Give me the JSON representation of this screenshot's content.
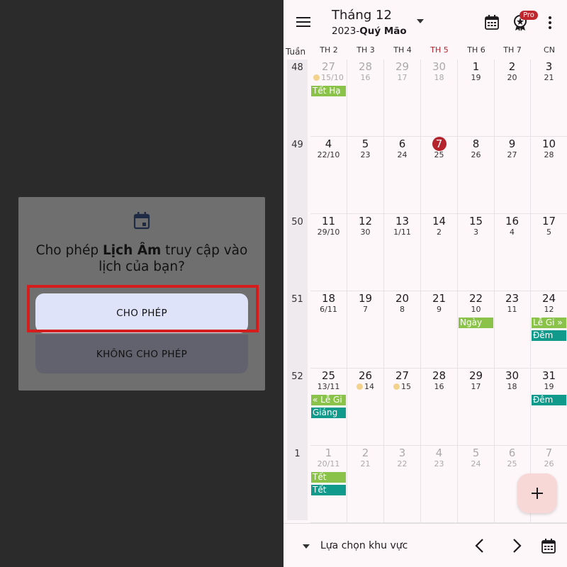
{
  "dialog": {
    "title_pre": "Cho phép ",
    "title_app": "Lịch Âm",
    "title_post": " truy cập vào lịch của bạn?",
    "allow_label": "CHO PHÉP",
    "deny_label": "KHÔNG CHO PHÉP",
    "icon": "calendar-icon"
  },
  "header": {
    "month": "Tháng 12",
    "year": "2023-",
    "year_name": "Quý Mão",
    "pro_badge": "Pro"
  },
  "week_header": "Tuần",
  "days": [
    "TH 2",
    "TH 3",
    "TH 4",
    "TH 5",
    "TH 6",
    "TH 7",
    "CN"
  ],
  "weeks": [
    {
      "num": "48",
      "cells": [
        {
          "d": "27",
          "l": "15/10",
          "dim": true,
          "moon": true,
          "events": [
            {
              "t": "Tết Hạ",
              "c": "g"
            }
          ]
        },
        {
          "d": "28",
          "l": "16",
          "dim": true
        },
        {
          "d": "29",
          "l": "17",
          "dim": true
        },
        {
          "d": "30",
          "l": "18",
          "dim": true
        },
        {
          "d": "1",
          "l": "19"
        },
        {
          "d": "2",
          "l": "20"
        },
        {
          "d": "3",
          "l": "21"
        }
      ]
    },
    {
      "num": "49",
      "cells": [
        {
          "d": "4",
          "l": "22/10"
        },
        {
          "d": "5",
          "l": "23"
        },
        {
          "d": "6",
          "l": "24"
        },
        {
          "d": "7",
          "l": "25",
          "today": true
        },
        {
          "d": "8",
          "l": "26"
        },
        {
          "d": "9",
          "l": "27"
        },
        {
          "d": "10",
          "l": "28"
        }
      ]
    },
    {
      "num": "50",
      "cells": [
        {
          "d": "11",
          "l": "29/10"
        },
        {
          "d": "12",
          "l": "30"
        },
        {
          "d": "13",
          "l": "1/11"
        },
        {
          "d": "14",
          "l": "2"
        },
        {
          "d": "15",
          "l": "3"
        },
        {
          "d": "16",
          "l": "4"
        },
        {
          "d": "17",
          "l": "5"
        }
      ]
    },
    {
      "num": "51",
      "cells": [
        {
          "d": "18",
          "l": "6/11"
        },
        {
          "d": "19",
          "l": "7"
        },
        {
          "d": "20",
          "l": "8"
        },
        {
          "d": "21",
          "l": "9"
        },
        {
          "d": "22",
          "l": "10",
          "events": [
            {
              "t": "Ngày",
              "c": "g"
            }
          ]
        },
        {
          "d": "23",
          "l": "11"
        },
        {
          "d": "24",
          "l": "12",
          "events": [
            {
              "t": "Lễ Gi »",
              "c": "g"
            },
            {
              "t": "Đêm",
              "c": "t"
            }
          ]
        }
      ]
    },
    {
      "num": "52",
      "cells": [
        {
          "d": "25",
          "l": "13/11",
          "events": [
            {
              "t": "« Lễ Gi",
              "c": "g"
            },
            {
              "t": "Giáng",
              "c": "t"
            }
          ]
        },
        {
          "d": "26",
          "l": "14",
          "moon": true
        },
        {
          "d": "27",
          "l": "15",
          "moon": true
        },
        {
          "d": "28",
          "l": "16"
        },
        {
          "d": "29",
          "l": "17"
        },
        {
          "d": "30",
          "l": "18"
        },
        {
          "d": "31",
          "l": "19",
          "events": [
            {
              "t": "Đêm",
              "c": "t"
            }
          ]
        }
      ]
    },
    {
      "num": "1",
      "cells": [
        {
          "d": "1",
          "l": "20/11",
          "dim": true,
          "events": [
            {
              "t": "Tết",
              "c": "g"
            },
            {
              "t": "Tết",
              "c": "t"
            }
          ]
        },
        {
          "d": "2",
          "l": "21",
          "dim": true
        },
        {
          "d": "3",
          "l": "22",
          "dim": true
        },
        {
          "d": "4",
          "l": "23",
          "dim": true
        },
        {
          "d": "5",
          "l": "24",
          "dim": true
        },
        {
          "d": "6",
          "l": "25",
          "dim": true
        },
        {
          "d": "7",
          "l": "26",
          "dim": true
        }
      ]
    }
  ],
  "footer": {
    "region_label": "Lựa chọn khu vực"
  },
  "colors": {
    "today": "#b5232c",
    "event_green": "#8bc34a",
    "event_teal": "#0f9a8c",
    "highlight_border": "#d61d1d"
  }
}
